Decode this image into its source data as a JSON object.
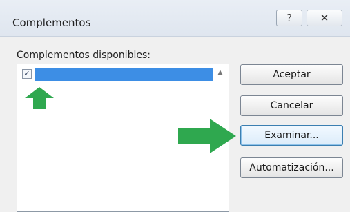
{
  "window": {
    "title": "Complementos",
    "help_glyph": "?",
    "close_glyph": "✕"
  },
  "list": {
    "label": "Complementos disponibles:",
    "items": [
      {
        "label": "",
        "checked": true,
        "selected": true,
        "check_glyph": "✓"
      }
    ],
    "scroll_up_glyph": "▲"
  },
  "buttons": {
    "accept": "Aceptar",
    "cancel": "Cancelar",
    "browse": "Examinar...",
    "automation": "Automatización..."
  },
  "annotations": {
    "arrow_color": "#2fa84f"
  },
  "colors": {
    "selection": "#3d8ee5",
    "focus_border": "#3c7fb1"
  }
}
